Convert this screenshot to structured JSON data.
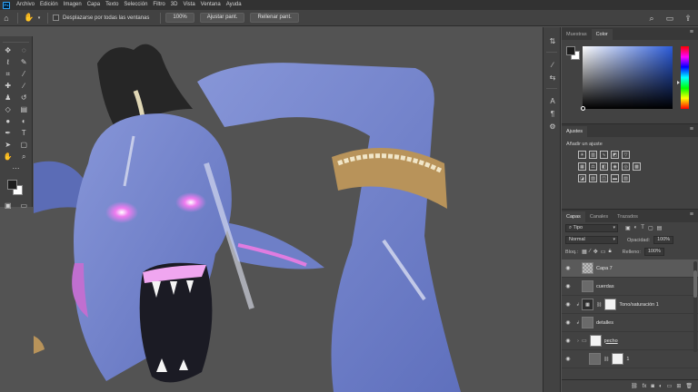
{
  "app": {
    "logo_text": "Ps"
  },
  "menu": [
    "Archivo",
    "Edición",
    "Imagen",
    "Capa",
    "Texto",
    "Selección",
    "Filtro",
    "3D",
    "Vista",
    "Ventana",
    "Ayuda"
  ],
  "options": {
    "scroll_all_label": "Desplazarse por todas las ventanas",
    "zoom_value": "100%",
    "fit_label": "Ajustar pant.",
    "fill_label": "Rellenar pant."
  },
  "panels": {
    "color_tabs": [
      "Muestras",
      "Color"
    ],
    "adjust_tab": "Ajustes",
    "adjust_subtitle": "Añadir un ajuste",
    "layer_tabs": [
      "Capas",
      "Canales",
      "Trazados"
    ]
  },
  "layers": {
    "filter_value": "Tipo",
    "blend_mode": "Normal",
    "opacity_label": "Opacidad:",
    "opacity_value": "100%",
    "lock_label": "Bloq.:",
    "fill_label": "Relleno:",
    "fill_value": "100%",
    "items": [
      {
        "name": "Capa 7",
        "selected": true
      },
      {
        "name": "cuerdas"
      },
      {
        "name": "Tono/saturación 1"
      },
      {
        "name": "detalles"
      },
      {
        "name": "pecho"
      },
      {
        "name": "1"
      }
    ]
  },
  "colors": {
    "ui_dark": "#323232",
    "panel": "#424242",
    "canvas_bg": "#535353",
    "skin_blue": "#6f80c8",
    "accent_pink": "#e86fe8"
  }
}
